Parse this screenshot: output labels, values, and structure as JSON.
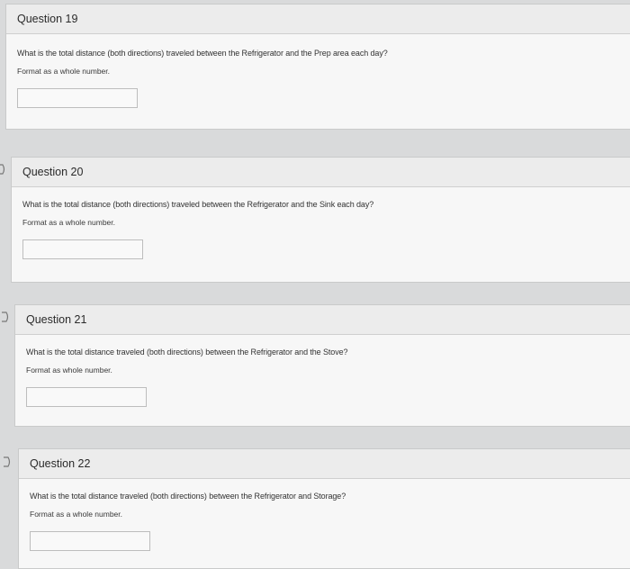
{
  "questions": [
    {
      "title": "Question 19",
      "prompt": "What is the total distance (both directions) traveled between the Refrigerator and the Prep area each day?",
      "format": "Format as a whole number.",
      "answer": ""
    },
    {
      "title": "Question 20",
      "prompt": "What is the total distance (both directions) traveled between the Refrigerator and the Sink each day?",
      "format": "Format as a whole number.",
      "answer": ""
    },
    {
      "title": "Question 21",
      "prompt": "What is the total distance traveled (both directions) between the Refrigerator and the Stove?",
      "format": "Format as whole number.",
      "answer": ""
    },
    {
      "title": "Question 22",
      "prompt": "What is the total distance traveled (both directions) between the Refrigerator and Storage?",
      "format": "Format as a whole number.",
      "answer": ""
    }
  ],
  "icons": {
    "flag": "flag-icon"
  },
  "colors": {
    "page_background": "#d9dadb",
    "card_background": "#f7f7f7",
    "header_background": "#ececec"
  }
}
